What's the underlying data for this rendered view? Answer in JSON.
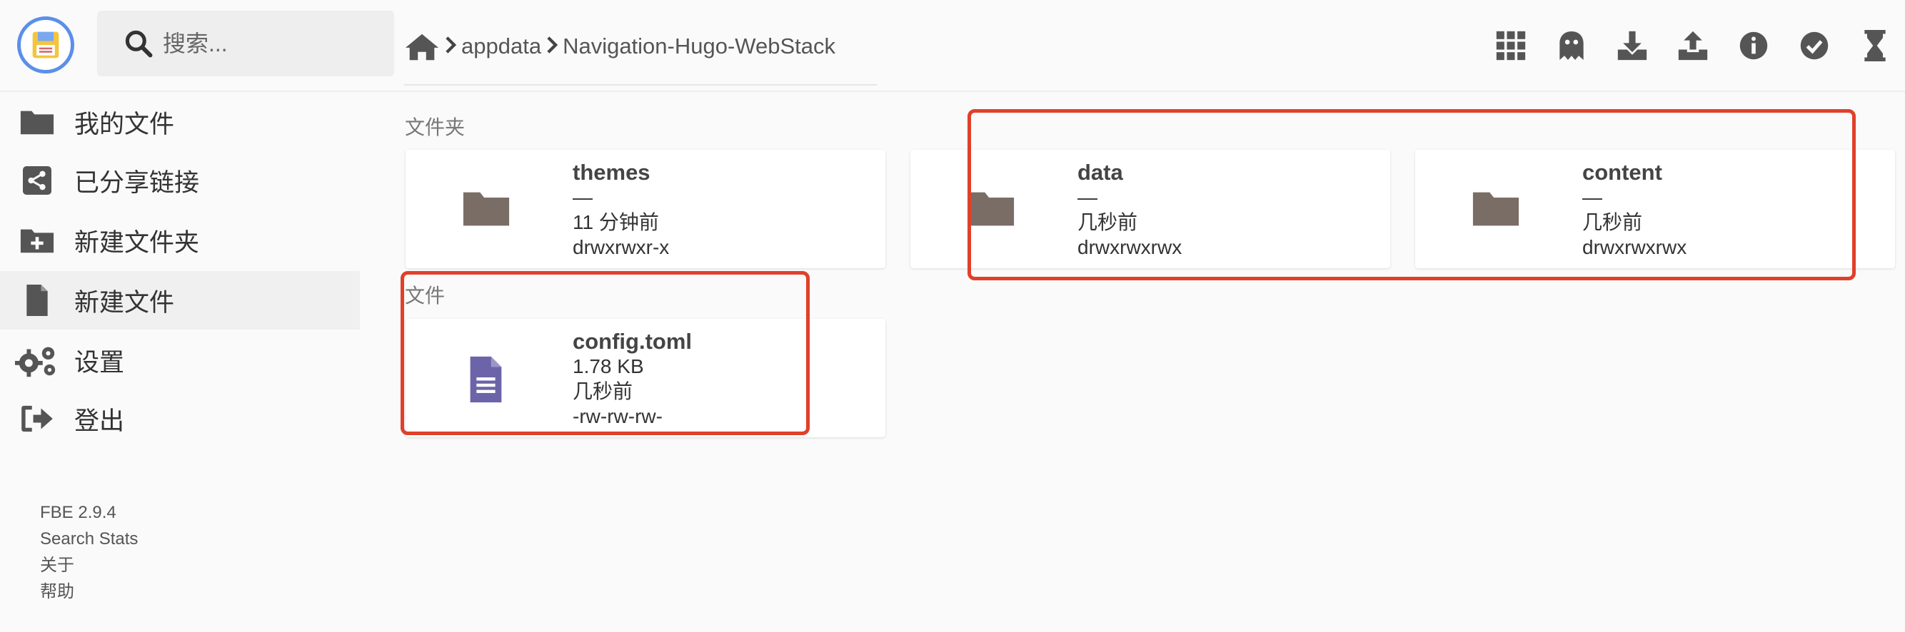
{
  "search": {
    "placeholder": "搜索..."
  },
  "breadcrumb": {
    "items": [
      "appdata",
      "Navigation-Hugo-WebStack"
    ]
  },
  "sidebar": {
    "items": [
      {
        "label": "我的文件"
      },
      {
        "label": "已分享链接"
      },
      {
        "label": "新建文件夹"
      },
      {
        "label": "新建文件"
      },
      {
        "label": "设置"
      },
      {
        "label": "登出"
      }
    ],
    "footer": [
      "FBE 2.9.4",
      "Search Stats",
      "关于",
      "帮助"
    ]
  },
  "sections": {
    "folders": "文件夹",
    "files": "文件"
  },
  "folders": [
    {
      "name": "themes",
      "size": "—",
      "modified": "11 分钟前",
      "perms": "drwxrwxr-x"
    },
    {
      "name": "data",
      "size": "—",
      "modified": "几秒前",
      "perms": "drwxrwxrwx"
    },
    {
      "name": "content",
      "size": "—",
      "modified": "几秒前",
      "perms": "drwxrwxrwx"
    }
  ],
  "files": [
    {
      "name": "config.toml",
      "size": "1.78 KB",
      "modified": "几秒前",
      "perms": "-rw-rw-rw-"
    }
  ],
  "toolbar_icons": [
    "grid-view-icon",
    "ghost-icon",
    "download-icon",
    "upload-icon",
    "info-icon",
    "check-circle-icon",
    "hourglass-icon"
  ],
  "colors": {
    "accent": "#5b8fe9",
    "folder": "#7a6d66",
    "file": "#6c64a8",
    "highlight": "#e0402a"
  }
}
